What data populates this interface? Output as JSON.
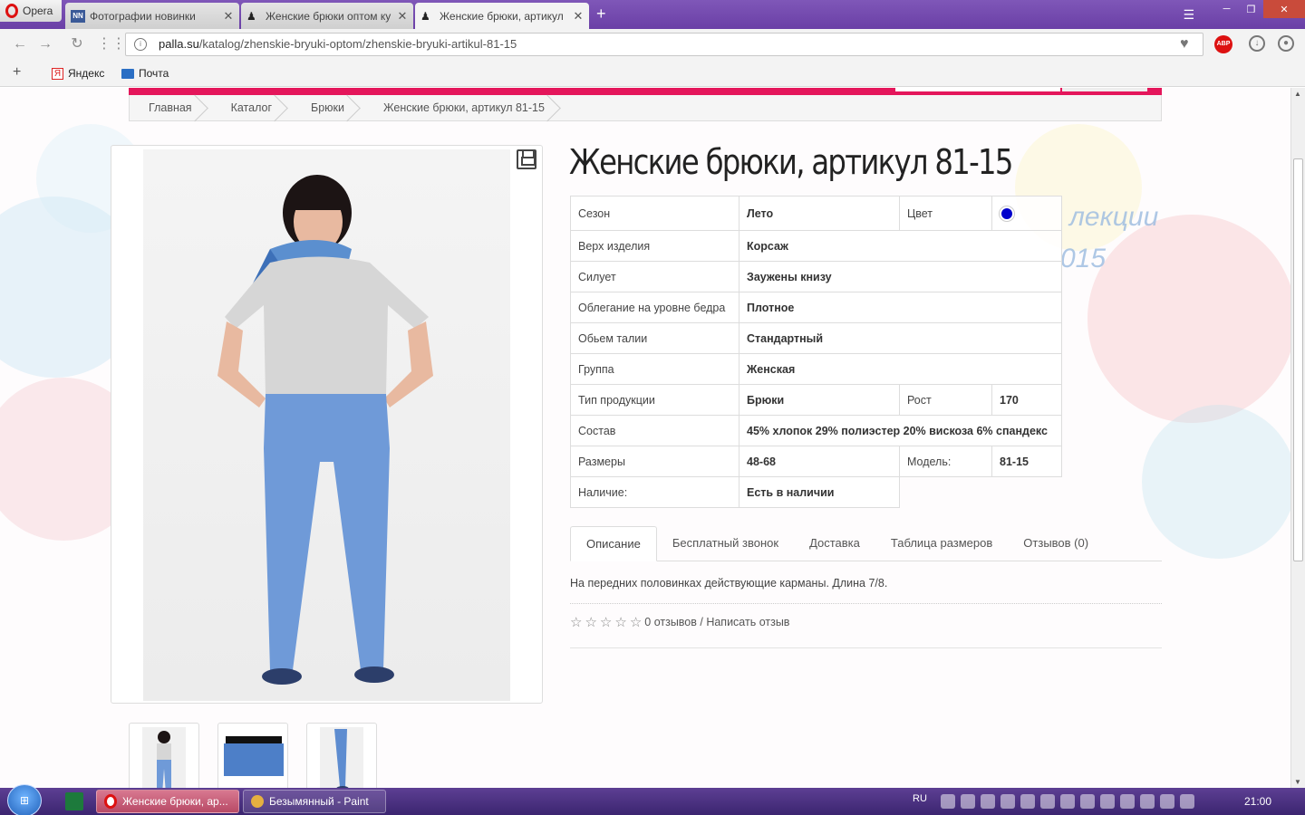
{
  "browser": {
    "menu_label": "Opera",
    "tabs": [
      {
        "label": "Фотографии новинки"
      },
      {
        "label": "Женские брюки оптом ку"
      },
      {
        "label": "Женские брюки, артикул"
      }
    ],
    "url_domain": "palla.su",
    "url_path": "/katalog/zhenskie-bryuki-optom/zhenskie-bryuki-artikul-81-15",
    "bookmarks": [
      {
        "label": "Яндекс"
      },
      {
        "label": "Почта"
      }
    ],
    "abp_label": "ABP"
  },
  "breadcrumb": [
    "Главная",
    "Каталог",
    "Брюки",
    "Женские брюки, артикул 81-15"
  ],
  "product": {
    "title": "Женские брюки, артикул 81-15",
    "specs": {
      "season_label": "Сезон",
      "season_value": "Лето",
      "color_label": "Цвет",
      "color_hex": "#0000cc",
      "top_label": "Верх изделия",
      "top_value": "Корсаж",
      "silhouette_label": "Силует",
      "silhouette_value": "Заужены книзу",
      "hip_label": "Облегание на уровне бедра",
      "hip_value": "Плотное",
      "waist_label": "Обьем талии",
      "waist_value": "Стандартный",
      "group_label": "Группа",
      "group_value": "Женская",
      "type_label": "Тип продукции",
      "type_value": "Брюки",
      "height_label": "Рост",
      "height_value": "170",
      "composition_label": "Состав",
      "composition_value": "45% хлопок 29% полиэстер 20% вискоза 6% спандекс",
      "sizes_label": "Размеры",
      "sizes_value": "48-68",
      "model_label": "Модель:",
      "model_value": "81-15",
      "avail_label": "Наличие:",
      "avail_value": "Есть в наличии"
    },
    "tabs": [
      "Описание",
      "Бесплатный звонок",
      "Доставка",
      "Таблица размеров",
      "Отзывов (0)"
    ],
    "description": "На передних половинках действующие карманы. Длина 7/8.",
    "rating_stars": 0,
    "reviews_text": "0 отзывов / Написать отзыв"
  },
  "watermark": {
    "line1": "лекции",
    "line2": "015"
  },
  "taskbar": {
    "buttons": [
      {
        "label": "Женские брюки, ар..."
      },
      {
        "label": "Безымянный - Paint"
      }
    ],
    "lang": "RU",
    "clock": "21:00",
    "start_label": "⊞"
  },
  "colors": {
    "accent": "#e4165b",
    "tabbar": "#7f57b8",
    "taskbar": "#4a2f80"
  }
}
